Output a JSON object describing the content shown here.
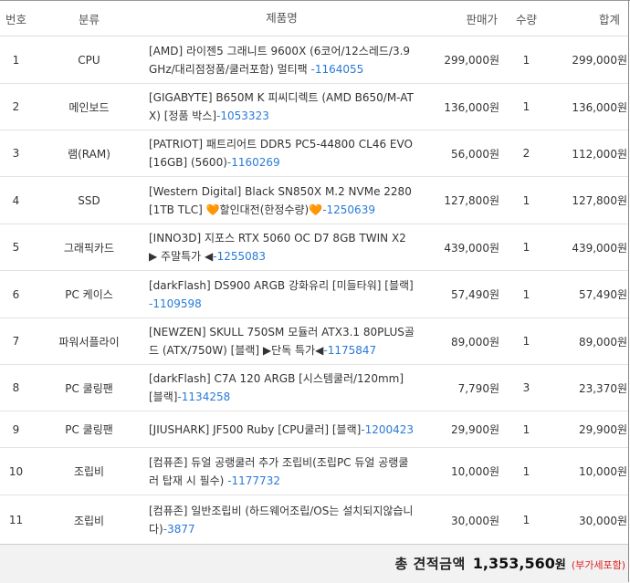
{
  "headers": {
    "no": "번호",
    "category": "분류",
    "product": "제품명",
    "price": "판매가",
    "qty": "수량",
    "total": "합계"
  },
  "rows": [
    {
      "no": "1",
      "category": "CPU",
      "name": "[AMD] 라이젠5 그래니트 9600X (6코어/12스레드/3.9GHz/대리점정품/쿨러포함) 멀티팩 ",
      "code": "-1164055",
      "price": "299,000원",
      "qty": "1",
      "total": "299,000원"
    },
    {
      "no": "2",
      "category": "메인보드",
      "name": "[GIGABYTE] B650M K 피씨디렉트 (AMD B650/M-ATX) [정품 박스]",
      "code": "-1053323",
      "price": "136,000원",
      "qty": "1",
      "total": "136,000원"
    },
    {
      "no": "3",
      "category": "램(RAM)",
      "name": "[PATRIOT] 패트리어트 DDR5 PC5-44800 CL46 EVO [16GB] (5600)",
      "code": "-1160269",
      "price": "56,000원",
      "qty": "2",
      "total": "112,000원"
    },
    {
      "no": "4",
      "category": "SSD",
      "name_a": "[Western Digital] Black SN850X M.2 NVMe 2280 [1TB TLC] ",
      "heart": "🧡",
      "name_b": "할인대전(한정수량)",
      "code": "-1250639",
      "price": "127,800원",
      "qty": "1",
      "total": "127,800원"
    },
    {
      "no": "5",
      "category": "그래픽카드",
      "name": "[INNO3D] 지포스 RTX 5060 OC D7 8GB TWIN X2 ▶ 주말특가 ◀",
      "code": "-1255083",
      "price": "439,000원",
      "qty": "1",
      "total": "439,000원"
    },
    {
      "no": "6",
      "category": "PC 케이스",
      "name": "[darkFlash] DS900 ARGB 강화유리 [미들타워] [블랙]",
      "code": "-1109598",
      "price": "57,490원",
      "qty": "1",
      "total": "57,490원"
    },
    {
      "no": "7",
      "category": "파워서플라이",
      "name": "[NEWZEN] SKULL 750SM 모듈러 ATX3.1 80PLUS골드 (ATX/750W) [블랙] ▶단독 특가◀",
      "code": "-1175847",
      "price": "89,000원",
      "qty": "1",
      "total": "89,000원"
    },
    {
      "no": "8",
      "category": "PC 쿨링팬",
      "name": "[darkFlash] C7A 120 ARGB [시스템쿨러/120mm] [블랙]",
      "code": "-1134258",
      "price": "7,790원",
      "qty": "3",
      "total": "23,370원"
    },
    {
      "no": "9",
      "category": "PC 쿨링팬",
      "name": "[JIUSHARK] JF500 Ruby [CPU쿨러] [블랙]",
      "code": "-1200423",
      "price": "29,900원",
      "qty": "1",
      "total": "29,900원"
    },
    {
      "no": "10",
      "category": "조립비",
      "name": "[컴퓨존] 듀얼 공랭쿨러 추가 조립비(조립PC 듀얼 공랭쿨러 탑재 시 필수) ",
      "code": "-1177732",
      "price": "10,000원",
      "qty": "1",
      "total": "10,000원"
    },
    {
      "no": "11",
      "category": "조립비",
      "name": "[컴퓨존] 일반조립비 (하드웨어조립/OS는 설치되지않습니다)",
      "code": "-3877",
      "price": "30,000원",
      "qty": "1",
      "total": "30,000원"
    }
  ],
  "summary": {
    "label": "총 견적금액",
    "value": "1,353,560",
    "unit": "원",
    "vat_note": "(부가세포함)"
  },
  "colors": {
    "product_code": "#2a7ad6",
    "vat_note": "#e02020",
    "summary_bg": "#f2f2f2"
  }
}
